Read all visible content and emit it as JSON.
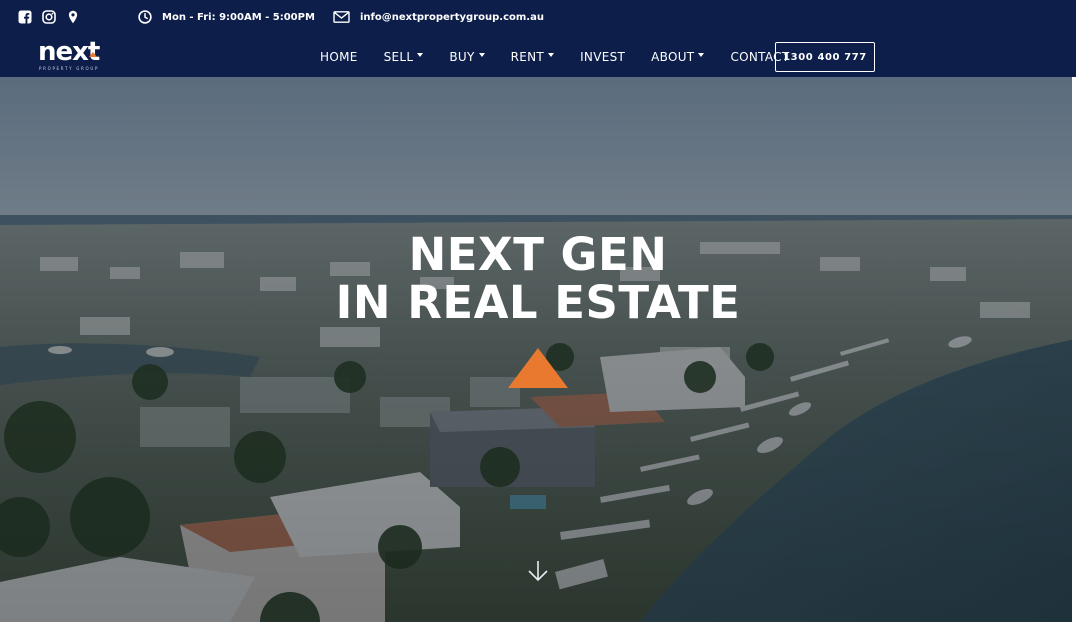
{
  "topbar": {
    "social_icons": [
      "facebook-icon",
      "instagram-icon",
      "location-pin-icon"
    ],
    "hours_icon": "clock-icon",
    "hours": "Mon - Fri: 9:00AM - 5:00PM",
    "email_icon": "envelope-icon",
    "email": "info@nextpropertygroup.com.au"
  },
  "logo": {
    "wordmark": "next",
    "tagline": "PROPERTY GROUP"
  },
  "nav": {
    "items": [
      {
        "label": "HOME",
        "dropdown": false
      },
      {
        "label": "SELL",
        "dropdown": true
      },
      {
        "label": "BUY",
        "dropdown": true
      },
      {
        "label": "RENT",
        "dropdown": true
      },
      {
        "label": "INVEST",
        "dropdown": false
      },
      {
        "label": "ABOUT",
        "dropdown": true
      },
      {
        "label": "CONTACT",
        "dropdown": false
      }
    ],
    "phone": "1300 400 777"
  },
  "hero": {
    "title_line1": "NEXT GEN",
    "title_line2": "IN REAL ESTATE",
    "scroll_icon": "arrow-down-icon"
  },
  "colors": {
    "header_bg": "#0d1e4b",
    "accent": "#e8792f",
    "water": "#3f5a66",
    "sky": "#8fa3b3"
  }
}
